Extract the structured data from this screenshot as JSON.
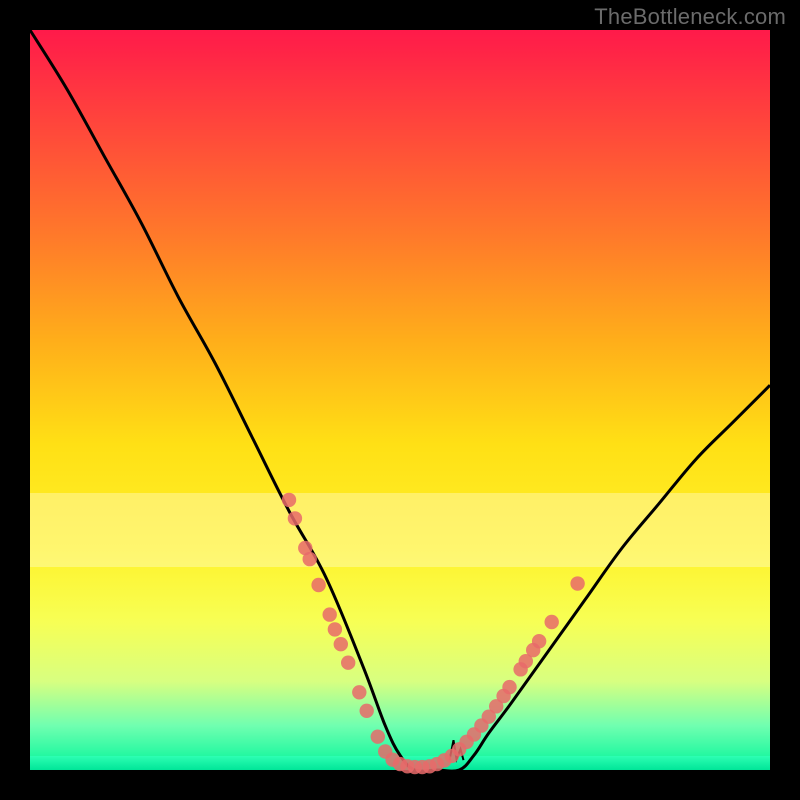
{
  "watermark": "TheBottleneck.com",
  "colors": {
    "frame": "#000000",
    "gradient_top": "#ff1a4a",
    "gradient_bottom": "#00f59a",
    "curve": "#000000",
    "dots": "#e86a6a",
    "watermark_text": "#6b6b6b"
  },
  "chart_data": {
    "type": "line",
    "title": "",
    "xlabel": "",
    "ylabel": "",
    "xlim": [
      0,
      100
    ],
    "ylim": [
      0,
      100
    ],
    "grid": false,
    "legend": false,
    "series": [
      {
        "name": "bottleneck-curve",
        "x": [
          0,
          5,
          10,
          15,
          20,
          25,
          30,
          35,
          40,
          45,
          48,
          50,
          52,
          55,
          58,
          60,
          62,
          65,
          70,
          75,
          80,
          85,
          90,
          95,
          100
        ],
        "values": [
          100,
          92,
          83,
          74,
          64,
          55,
          45,
          35,
          26,
          14,
          6,
          2,
          0,
          0,
          0,
          2,
          5,
          9,
          16,
          23,
          30,
          36,
          42,
          47,
          52
        ]
      }
    ],
    "dots": [
      {
        "x": 35.0,
        "y": 36.5
      },
      {
        "x": 35.8,
        "y": 34.0
      },
      {
        "x": 37.2,
        "y": 30.0
      },
      {
        "x": 37.8,
        "y": 28.5
      },
      {
        "x": 39.0,
        "y": 25.0
      },
      {
        "x": 40.5,
        "y": 21.0
      },
      {
        "x": 41.2,
        "y": 19.0
      },
      {
        "x": 42.0,
        "y": 17.0
      },
      {
        "x": 43.0,
        "y": 14.5
      },
      {
        "x": 44.5,
        "y": 10.5
      },
      {
        "x": 45.5,
        "y": 8.0
      },
      {
        "x": 47.0,
        "y": 4.5
      },
      {
        "x": 48.0,
        "y": 2.5
      },
      {
        "x": 49.0,
        "y": 1.4
      },
      {
        "x": 50.0,
        "y": 0.8
      },
      {
        "x": 51.0,
        "y": 0.5
      },
      {
        "x": 52.0,
        "y": 0.4
      },
      {
        "x": 53.0,
        "y": 0.4
      },
      {
        "x": 54.0,
        "y": 0.5
      },
      {
        "x": 55.0,
        "y": 0.8
      },
      {
        "x": 56.0,
        "y": 1.3
      },
      {
        "x": 57.0,
        "y": 1.9
      },
      {
        "x": 58.0,
        "y": 2.8
      },
      {
        "x": 59.0,
        "y": 3.8
      },
      {
        "x": 60.0,
        "y": 4.8
      },
      {
        "x": 61.0,
        "y": 6.0
      },
      {
        "x": 62.0,
        "y": 7.2
      },
      {
        "x": 63.0,
        "y": 8.6
      },
      {
        "x": 64.0,
        "y": 10.0
      },
      {
        "x": 64.8,
        "y": 11.2
      },
      {
        "x": 66.3,
        "y": 13.6
      },
      {
        "x": 67.0,
        "y": 14.7
      },
      {
        "x": 68.0,
        "y": 16.2
      },
      {
        "x": 68.8,
        "y": 17.4
      },
      {
        "x": 70.5,
        "y": 20.0
      },
      {
        "x": 74.0,
        "y": 25.2
      }
    ],
    "pale_band_y": [
      27.5,
      37.5
    ]
  }
}
